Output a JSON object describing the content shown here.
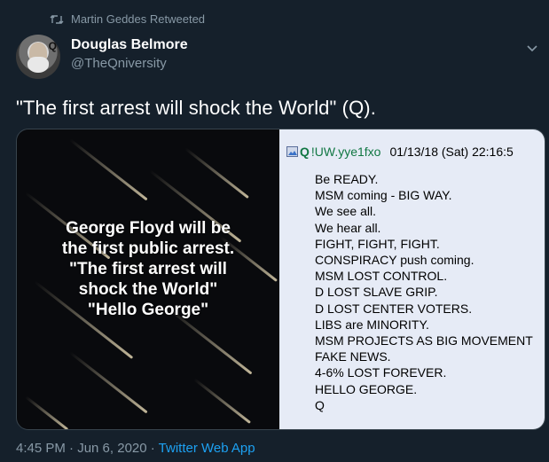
{
  "retweet": {
    "text": "Martin Geddes Retweeted",
    "icon": "retweet-icon"
  },
  "author": {
    "name": "Douglas Belmore",
    "handle": "@TheQniversity"
  },
  "tweet": {
    "text": "\"The first arrest will shock the World\" (Q)."
  },
  "media": {
    "left_image": {
      "lines": [
        "George Floyd will be",
        "the first public arrest.",
        "\"The first arrest will",
        "shock the World\"",
        "\"Hello George\""
      ]
    },
    "right_post": {
      "name": "Q",
      "tripcode": "!UW.yye1fxo",
      "date": "01/13/18 (Sat) 22:16:5",
      "lines": [
        "Be READY.",
        "MSM coming - BIG WAY.",
        "We see all.",
        "We hear all.",
        "FIGHT, FIGHT, FIGHT.",
        "CONSPIRACY push coming.",
        "MSM LOST CONTROL.",
        "D LOST SLAVE GRIP.",
        "D LOST CENTER VOTERS.",
        "LIBS are MINORITY.",
        "MSM PROJECTS AS BIG MOVEMENT",
        "FAKE NEWS.",
        "4-6% LOST FOREVER.",
        "HELLO GEORGE.",
        "Q"
      ]
    }
  },
  "footer": {
    "time": "4:45 PM · Jun 6, 2020 · ",
    "app": "Twitter Web App"
  },
  "colors": {
    "background": "#15202b",
    "muted": "#8899a6",
    "link": "#1da1f2",
    "q_green": "#117743",
    "post_bg": "#e6ebf6"
  }
}
